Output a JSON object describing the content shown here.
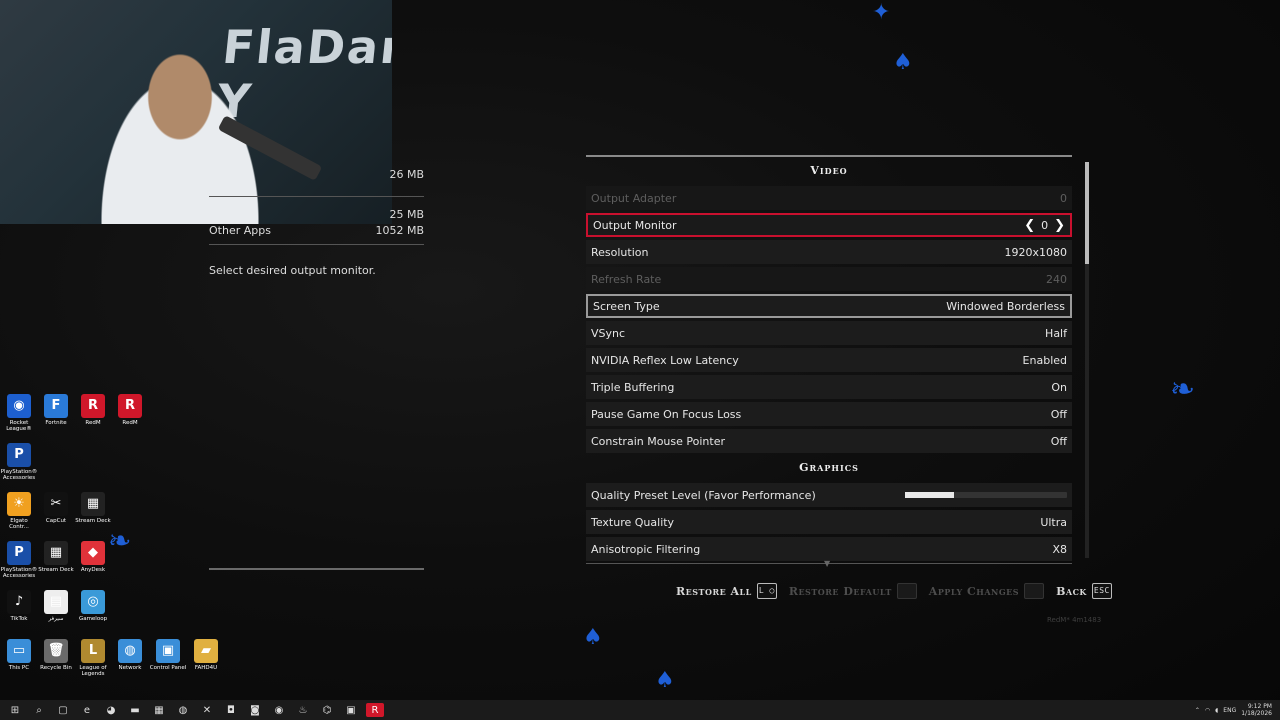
{
  "overlay": {
    "wall_text": "FlaDan Y"
  },
  "info_panel": {
    "memory_rows": [
      {
        "label": "",
        "value": "26 MB"
      },
      {
        "label": "",
        "value": "25 MB"
      },
      {
        "label": "Other Apps",
        "value": "1052 MB"
      }
    ],
    "description": "Select desired output monitor."
  },
  "video_section": {
    "title": "Video",
    "rows": [
      {
        "label": "Output Adapter",
        "value": "0",
        "state": "disabled"
      },
      {
        "label": "Output Monitor",
        "value": "0",
        "state": "selected"
      },
      {
        "label": "Resolution",
        "value": "1920x1080",
        "state": "normal"
      },
      {
        "label": "Refresh Rate",
        "value": "240",
        "state": "disabled"
      },
      {
        "label": "Screen Type",
        "value": "Windowed Borderless",
        "state": "hover"
      },
      {
        "label": "VSync",
        "value": "Half",
        "state": "normal"
      },
      {
        "label": "NVIDIA Reflex Low Latency",
        "value": "Enabled",
        "state": "normal"
      },
      {
        "label": "Triple Buffering",
        "value": "On",
        "state": "normal"
      },
      {
        "label": "Pause Game On Focus Loss",
        "value": "Off",
        "state": "normal"
      },
      {
        "label": "Constrain Mouse Pointer",
        "value": "Off",
        "state": "normal"
      }
    ]
  },
  "graphics_section": {
    "title": "Graphics",
    "quality_preset": {
      "label": "Quality Preset Level (Favor Performance)",
      "level": 0.3
    },
    "rows": [
      {
        "label": "Texture Quality",
        "value": "Ultra"
      },
      {
        "label": "Anisotropic Filtering",
        "value": "X8"
      }
    ]
  },
  "footer": {
    "restore_all": {
      "label": "Restore All",
      "key": "L ◯"
    },
    "restore_default": {
      "label": "Restore Default",
      "key": ""
    },
    "apply_changes": {
      "label": "Apply Changes",
      "key": ""
    },
    "back": {
      "label": "Back",
      "key": "ESC"
    }
  },
  "build_text": "RedM* 4m1483",
  "desktop_icons": [
    {
      "label": "Rocket League®",
      "glyph": "◉",
      "color": "#1d5fcf"
    },
    {
      "label": "Fortnite",
      "glyph": "F",
      "color": "#2a7ad8"
    },
    {
      "label": "RedM",
      "glyph": "R",
      "color": "#d0172a"
    },
    {
      "label": "RedM",
      "glyph": "R",
      "color": "#d0172a"
    },
    {
      "label": "PlayStation® Accessories",
      "glyph": "P",
      "color": "#1a4fa8"
    },
    {
      "label": "Elgato Contr...",
      "glyph": "☀",
      "color": "#f0a020"
    },
    {
      "label": "CapCut",
      "glyph": "✂",
      "color": "#111111"
    },
    {
      "label": "Stream Deck",
      "glyph": "▦",
      "color": "#222222"
    },
    {
      "label": "PlayStation® Accessories",
      "glyph": "P",
      "color": "#1a4fa8"
    },
    {
      "label": "Stream Deck",
      "glyph": "▦",
      "color": "#222222"
    },
    {
      "label": "AnyDesk",
      "glyph": "◆",
      "color": "#e0323a"
    },
    {
      "label": "TikTok",
      "glyph": "♪",
      "color": "#111111"
    },
    {
      "label": "سيرفر",
      "glyph": "▤",
      "color": "#eeeeee"
    },
    {
      "label": "Gameloop",
      "glyph": "◎",
      "color": "#3a9ad8"
    },
    {
      "label": "This PC",
      "glyph": "▭",
      "color": "#3a8ed8"
    },
    {
      "label": "Recycle Bin",
      "glyph": "🗑",
      "color": "#6a6a6a"
    },
    {
      "label": "League of Legends",
      "glyph": "L",
      "color": "#b08a30"
    },
    {
      "label": "Network",
      "glyph": "◍",
      "color": "#3a8ed8"
    },
    {
      "label": "Control Panel",
      "glyph": "▣",
      "color": "#3a8ed8"
    },
    {
      "label": "FAHD4U",
      "glyph": "▰",
      "color": "#e0b040"
    }
  ],
  "taskbar": {
    "icons": [
      {
        "name": "start-icon",
        "glyph": "⊞"
      },
      {
        "name": "search-icon",
        "glyph": "⌕"
      },
      {
        "name": "taskview-icon",
        "glyph": "▢"
      },
      {
        "name": "edge-icon",
        "glyph": "e"
      },
      {
        "name": "discord-icon",
        "glyph": "◕"
      },
      {
        "name": "explorer-icon",
        "glyph": "▬"
      },
      {
        "name": "store-icon",
        "glyph": "▦"
      },
      {
        "name": "app-icon",
        "glyph": "◍"
      },
      {
        "name": "xbox-icon",
        "glyph": "✕"
      },
      {
        "name": "app2-icon",
        "glyph": "◘"
      },
      {
        "name": "app3-icon",
        "glyph": "◙"
      },
      {
        "name": "chrome-icon",
        "glyph": "◉"
      },
      {
        "name": "steam-icon",
        "glyph": "♨"
      },
      {
        "name": "app4-icon",
        "glyph": "⌬"
      },
      {
        "name": "app5-icon",
        "glyph": "▣"
      },
      {
        "name": "redm-icon",
        "glyph": "R"
      }
    ],
    "language": "ENG",
    "time": "9:12 PM",
    "date": "1/18/2026"
  },
  "colors": {
    "selected_border": "#c8102e",
    "accent_blue": "#1f5fd6"
  }
}
